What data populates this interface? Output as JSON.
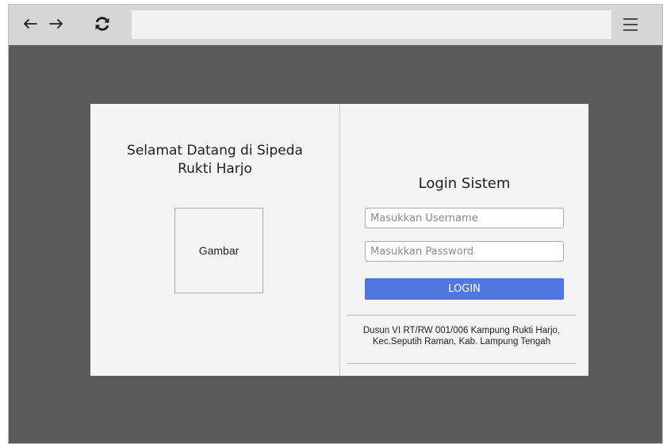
{
  "browser": {
    "back_icon": "arrow-left-icon",
    "forward_icon": "arrow-right-icon",
    "reload_icon": "refresh-icon",
    "menu_icon": "hamburger-menu-icon",
    "address_value": ""
  },
  "left_panel": {
    "welcome_line1": "Selamat Datang di Sipeda",
    "welcome_line2": "Rukti Harjo",
    "image_placeholder": "Gambar"
  },
  "login": {
    "title": "Login Sistem",
    "username_placeholder": "Masukkan Username",
    "password_placeholder": "Masukkan Password",
    "button_label": "LOGIN",
    "address_line1": "Dusun VI RT/RW 001/006 Kampung Rukti Harjo,",
    "address_line2": "Kec.Seputih Raman, Kab. Lampung Tengah"
  },
  "colors": {
    "background": "#5b5b5b",
    "toolbar": "#d6d6d6",
    "card": "#f4f4f4",
    "accent": "#5176e0"
  }
}
